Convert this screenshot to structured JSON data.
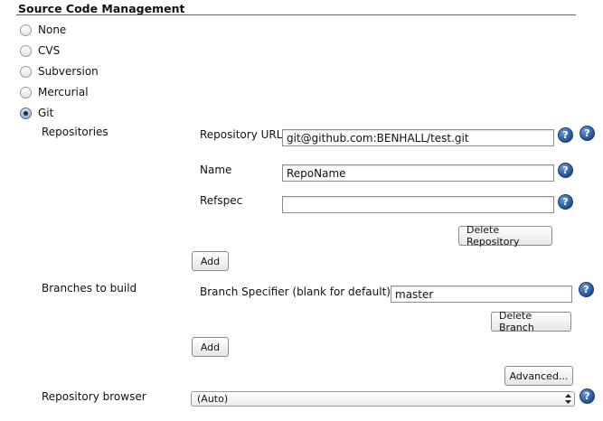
{
  "section": {
    "title": "Source Code Management"
  },
  "scm_options": [
    {
      "label": "None",
      "selected": false
    },
    {
      "label": "CVS",
      "selected": false
    },
    {
      "label": "Subversion",
      "selected": false
    },
    {
      "label": "Mercurial",
      "selected": false
    },
    {
      "label": "Git",
      "selected": true
    }
  ],
  "repositories": {
    "label": "Repositories",
    "url_label": "Repository URL",
    "url_value": "git@github.com:BENHALL/test.git",
    "name_label": "Name",
    "name_value": "RepoName",
    "refspec_label": "Refspec",
    "refspec_value": "",
    "delete_button": "Delete Repository",
    "add_button": "Add"
  },
  "branches": {
    "label": "Branches to build",
    "specifier_label": "Branch Specifier (blank for default):",
    "specifier_value": "master",
    "delete_button": "Delete Branch",
    "add_button": "Add"
  },
  "advanced_button": "Advanced...",
  "repo_browser": {
    "label": "Repository browser",
    "selected": "(Auto)"
  },
  "help_glyph": "?",
  "icons": {
    "help": "help-icon",
    "select_arrows": "select-arrows-icon"
  }
}
